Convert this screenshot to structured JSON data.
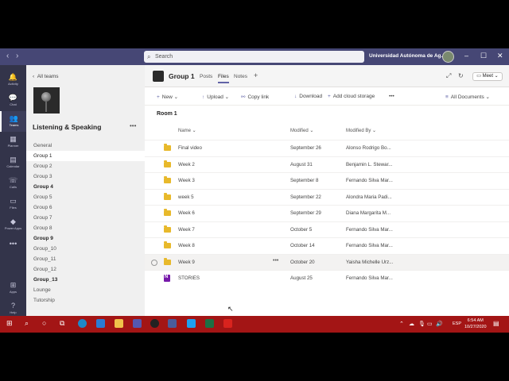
{
  "titlebar": {
    "back": "‹",
    "forward": "›",
    "search_placeholder": "Search",
    "org": "Universidad Autónoma de Ag...",
    "minimize": "–",
    "maximize": "☐",
    "close": "✕"
  },
  "rail": [
    {
      "label": "Activity",
      "icon": "bell-icon",
      "glyph": "🔔"
    },
    {
      "label": "Chat",
      "icon": "chat-icon",
      "glyph": "💬"
    },
    {
      "label": "Teams",
      "icon": "teams-icon",
      "glyph": "👥"
    },
    {
      "label": "Planner",
      "icon": "planner-icon",
      "glyph": "▦"
    },
    {
      "label": "Calendar",
      "icon": "calendar-icon",
      "glyph": "▤"
    },
    {
      "label": "Calls",
      "icon": "phone-icon",
      "glyph": "☏"
    },
    {
      "label": "Files",
      "icon": "file-icon",
      "glyph": "▭"
    },
    {
      "label": "Power Apps",
      "icon": "power-apps-icon",
      "glyph": "◆"
    },
    {
      "label": "",
      "icon": "more-icon",
      "glyph": "•••"
    },
    {
      "label": "Apps",
      "icon": "apps-icon",
      "glyph": "⊞"
    },
    {
      "label": "Help",
      "icon": "help-icon",
      "glyph": "?"
    }
  ],
  "team": {
    "all_teams": "All teams",
    "name": "Listening & Speaking",
    "more": "•••",
    "channels": [
      {
        "label": "General",
        "bold": false
      },
      {
        "label": "Group 1",
        "bold": false,
        "selected": true
      },
      {
        "label": "Group 2",
        "bold": false
      },
      {
        "label": "Group 3",
        "bold": false
      },
      {
        "label": "Group 4",
        "bold": true
      },
      {
        "label": "Group 5",
        "bold": false
      },
      {
        "label": "Group 6",
        "bold": false
      },
      {
        "label": "Group 7",
        "bold": false
      },
      {
        "label": "Group 8",
        "bold": false
      },
      {
        "label": "Group 9",
        "bold": true
      },
      {
        "label": "Group_10",
        "bold": false
      },
      {
        "label": "Group_11",
        "bold": false
      },
      {
        "label": "Group_12",
        "bold": false
      },
      {
        "label": "Group_13",
        "bold": true
      },
      {
        "label": "Lounge",
        "bold": false
      },
      {
        "label": "Tutorship",
        "bold": false
      }
    ]
  },
  "header": {
    "title": "Group 1",
    "tabs": [
      "Posts",
      "Files",
      "Notes"
    ],
    "add_tab": "+",
    "meet": "Meet"
  },
  "toolbar": {
    "new": "New",
    "upload": "Upload",
    "copy_link": "Copy link",
    "download": "Download",
    "add_cloud": "Add cloud storage",
    "more": "•••",
    "view": "All Documents"
  },
  "breadcrumb": "Room 1",
  "columns": {
    "name": "Name",
    "modified": "Modified",
    "modified_by": "Modified By"
  },
  "files": [
    {
      "name": "Final video",
      "modified": "September 26",
      "by": "Alonso Rodrigo Bo...",
      "type": "folder"
    },
    {
      "name": "Week 2",
      "modified": "August 31",
      "by": "Benjamin L. Stewar...",
      "type": "folder"
    },
    {
      "name": "Week 3",
      "modified": "September 8",
      "by": "Fernando Silva Mar...",
      "type": "folder"
    },
    {
      "name": "week 5",
      "modified": "September 22",
      "by": "Alondra Maria Padi...",
      "type": "folder"
    },
    {
      "name": "Week 6",
      "modified": "September 29",
      "by": "Diana Margarita M...",
      "type": "folder"
    },
    {
      "name": "Week 7",
      "modified": "October 5",
      "by": "Fernando Silva Mar...",
      "type": "folder"
    },
    {
      "name": "Week 8",
      "modified": "October 14",
      "by": "Fernando Silva Mar...",
      "type": "folder"
    },
    {
      "name": "Week 9",
      "modified": "October 20",
      "by": "Yaisha Michelle Urz...",
      "type": "folder",
      "hover": true
    },
    {
      "name": "STORIES",
      "modified": "August 25",
      "by": "Fernando Silva Mar...",
      "type": "onenote"
    }
  ],
  "taskbar": {
    "language": "ESP",
    "time": "6:54 AM",
    "date": "10/27/2020"
  },
  "colors": {
    "accent": "#6264a7",
    "titlebar": "#464775",
    "rail": "#33344a",
    "taskbar": "#a31515",
    "folder": "#e8b92b"
  }
}
